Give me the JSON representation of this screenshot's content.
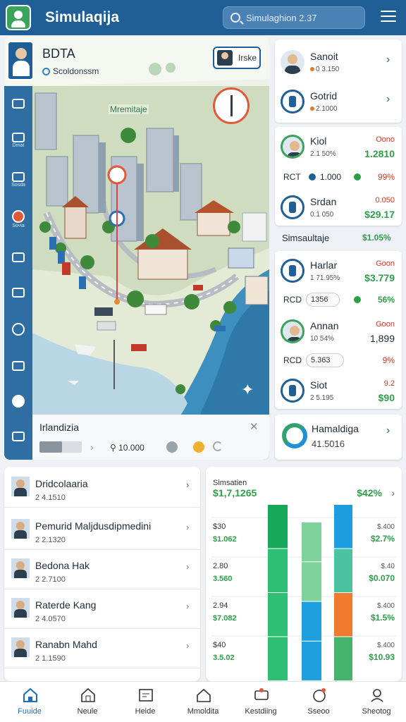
{
  "header": {
    "app_title": "Simulaqija",
    "search_placeholder": "Simulaghion 2.37",
    "icons": [
      "logo-icon",
      "search-icon",
      "menu-icon"
    ]
  },
  "profile": {
    "name": "BDTA",
    "subtitle": "Scoldonssm",
    "location_badge": "Irske"
  },
  "map": {
    "label": "Mremitaje",
    "rail_labels": [
      "",
      "Dmat",
      "Sosda",
      "Sovia",
      "",
      "",
      "",
      "",
      ""
    ]
  },
  "info_panel": {
    "title": "Irlandizia",
    "value": "10.000"
  },
  "right_cards": [
    {
      "name": "Sanoit",
      "sub": "0 3.150",
      "icon": "person"
    },
    {
      "name": "Gotrid",
      "sub": "2.1000",
      "icon": "brand"
    }
  ],
  "group1": {
    "rows": [
      {
        "name": "Kiol",
        "sub": "2.1 50%",
        "top": "Oono",
        "bottom": "1.2810"
      },
      {
        "name": "Srdan",
        "sub": "0.1 050",
        "top": "0.050",
        "bottom": "$29.17"
      }
    ],
    "stat": {
      "label": "RCT",
      "value": "1.000",
      "right": "99%"
    }
  },
  "mid": {
    "label": "Simsaultaje",
    "value": "$1.05%"
  },
  "group2": {
    "rows": [
      {
        "name": "Harlar",
        "sub": "1 71.95%",
        "top": "Goon",
        "bottom": "$3.779"
      },
      {
        "name": "Annan",
        "sub": "10 54%",
        "top": "Goon",
        "bottom": "1,899"
      },
      {
        "name": "Siot",
        "sub": "2 5.195",
        "top": "9.2",
        "bottom": "$90"
      }
    ],
    "stats": [
      {
        "label": "RCD",
        "value": "1356",
        "right": "56%"
      },
      {
        "label": "RCD",
        "value": "5.363",
        "right": "9%"
      }
    ]
  },
  "stat_card": {
    "name": "Hamaldiga",
    "value": "41.5016"
  },
  "list": [
    {
      "name": "Dridcolaaria",
      "sub": "2 4.1510"
    },
    {
      "name": "Pemurid Maljdusdipmedini",
      "sub": "2 2.1320"
    },
    {
      "name": "Bedona Hak",
      "sub": "2 2.7100"
    },
    {
      "name": "Raterde Kang",
      "sub": "2 4.0570"
    },
    {
      "name": "Ranabn Mahd",
      "sub": "2 1.1590"
    }
  ],
  "chart_data": {
    "type": "bar",
    "title": "Simsatien",
    "headline_left": "$1,7,1265",
    "headline_right": "$42%",
    "row_labels_left": [
      [
        "$30",
        "$1.062"
      ],
      [
        "2.80",
        "3.560"
      ],
      [
        "2.94",
        "$7.082"
      ],
      [
        "$40",
        "3.5.02"
      ]
    ],
    "row_labels_right": [
      [
        "$.400",
        "$2.7%"
      ],
      [
        "$.40",
        "$0.070"
      ],
      [
        "$.400",
        "$1.5%"
      ],
      [
        "$.400",
        "$10.93"
      ]
    ],
    "series": [
      {
        "values": [
          1.0,
          0.96,
          0.42,
          0.18
        ]
      },
      {
        "values": [
          0.9,
          0.62,
          0.3,
          0.12
        ]
      },
      {
        "values": [
          1.0,
          0.88,
          0.55,
          0.35
        ]
      }
    ],
    "colors": [
      "#1aaa5b",
      "#3cc37a",
      "#1e9de0",
      "#7ccf6e",
      "#ef7b2e",
      "#2ea86a"
    ]
  },
  "nav": [
    {
      "label": "Fuuide",
      "active": true
    },
    {
      "label": "Neule"
    },
    {
      "label": "Heide"
    },
    {
      "label": "Mmoldita"
    },
    {
      "label": "Kestdiing"
    },
    {
      "label": "Sseoo"
    },
    {
      "label": "Sheotog"
    }
  ]
}
